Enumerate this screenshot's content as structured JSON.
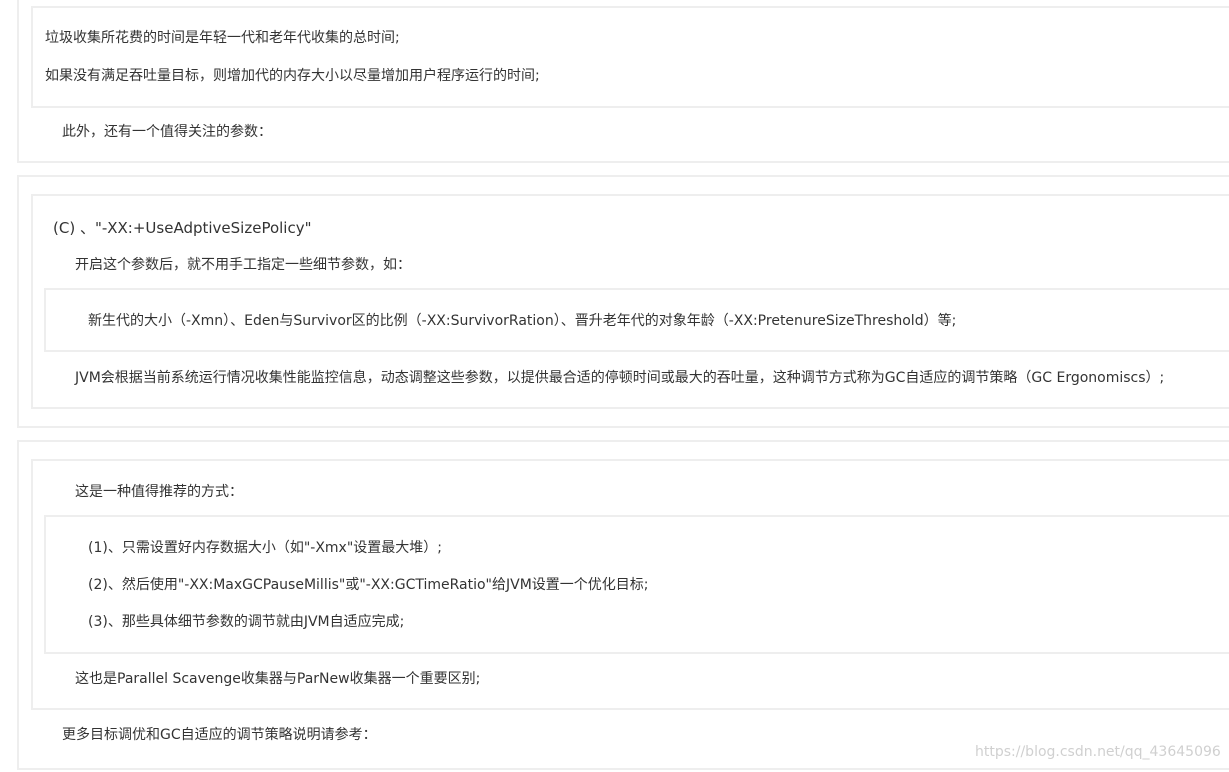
{
  "block1": {
    "quote": [
      "垃圾收集所花费的时间是年轻一代和老年代收集的总时间;",
      "如果没有满足吞吐量目标，则增加代的内存大小以尽量增加用户程序运行的时间;"
    ],
    "text": "此外，还有一个值得关注的参数："
  },
  "block2": {
    "heading": "(C) 、\"-XX:+UseAdptiveSizePolicy\"",
    "intro": "开启这个参数后，就不用手工指定一些细节参数，如：",
    "detail": "新生代的大小（-Xmn）、Eden与Survivor区的比例（-XX:SurvivorRation）、晋升老年代的对象年龄（-XX:PretenureSizeThreshold）等;",
    "summary": "JVM会根据当前系统运行情况收集性能监控信息，动态调整这些参数，以提供最合适的停顿时间或最大的吞吐量，这种调节方式称为GC自适应的调节策略（GC Ergonomiscs）;"
  },
  "block3": {
    "intro": "这是一种值得推荐的方式：",
    "steps": [
      "(1)、只需设置好内存数据大小（如\"-Xmx\"设置最大堆）;",
      "(2)、然后使用\"-XX:MaxGCPauseMillis\"或\"-XX:GCTimeRatio\"给JVM设置一个优化目标;",
      "(3)、那些具体细节参数的调节就由JVM自适应完成;"
    ],
    "note": "这也是Parallel Scavenge收集器与ParNew收集器一个重要区别;",
    "more": "更多目标调优和GC自适应的调节策略说明请参考："
  },
  "watermark": "https://blog.csdn.net/qq_43645096"
}
